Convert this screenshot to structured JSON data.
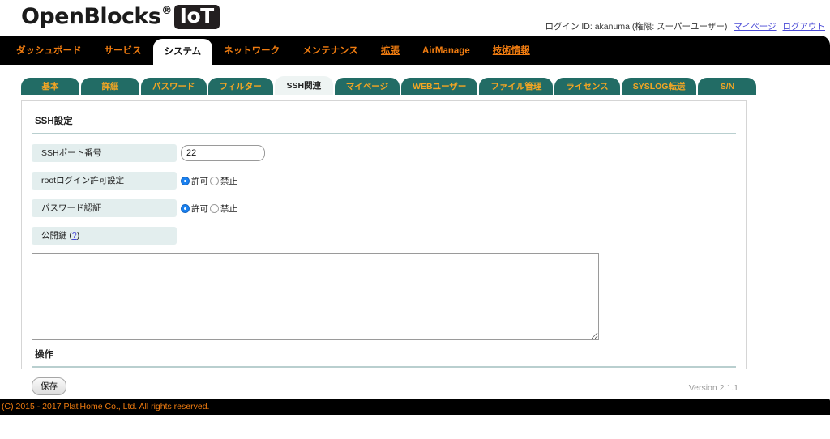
{
  "header": {
    "logo_main": "OpenBlocks",
    "logo_reg": "®",
    "logo_badge": "IoT",
    "login_text": "ログイン ID: akanuma (権限: スーパーユーザー)",
    "mypage_link": "マイページ",
    "logout_link": "ログアウト"
  },
  "mainnav": {
    "tabs": [
      {
        "label": "ダッシュボード",
        "active": false,
        "underline": false
      },
      {
        "label": "サービス",
        "active": false,
        "underline": false
      },
      {
        "label": "システム",
        "active": true,
        "underline": false
      },
      {
        "label": "ネットワーク",
        "active": false,
        "underline": false
      },
      {
        "label": "メンテナンス",
        "active": false,
        "underline": false
      },
      {
        "label": "拡張",
        "active": false,
        "underline": true
      },
      {
        "label": "AirManage",
        "active": false,
        "underline": false
      },
      {
        "label": "技術情報",
        "active": false,
        "underline": true
      }
    ]
  },
  "subnav": {
    "tabs": [
      {
        "label": "基本",
        "active": false
      },
      {
        "label": "詳細",
        "active": false
      },
      {
        "label": "パスワード",
        "active": false
      },
      {
        "label": "フィルター",
        "active": false
      },
      {
        "label": "SSH関連",
        "active": true
      },
      {
        "label": "マイページ",
        "active": false
      },
      {
        "label": "WEBユーザー",
        "active": false
      },
      {
        "label": "ファイル管理",
        "active": false
      },
      {
        "label": "ライセンス",
        "active": false
      },
      {
        "label": "SYSLOG転送",
        "active": false
      },
      {
        "label": "S/N",
        "active": false
      }
    ]
  },
  "panel": {
    "section_title": "SSH設定",
    "port_label": "SSHポート番号",
    "port_value": "22",
    "port_placeholder": "",
    "root_login_label": "rootログイン許可設定",
    "password_auth_label": "パスワード認証",
    "radio_allow": "許可",
    "radio_deny": "禁止",
    "root_login_selected": "許可",
    "password_auth_selected": "許可",
    "pubkey_label": "公開鍵",
    "pubkey_help": "(?)",
    "pubkey_help_mark": "?",
    "pubkey_value": "",
    "pubkey_placeholder": "",
    "operation_title": "操作",
    "save_label": "保存"
  },
  "footer": {
    "version": "Version 2.1.1",
    "copyright": "(C) 2015 - 2017 Plat'Home Co., Ltd. All rights reserved."
  },
  "colors": {
    "nav_bg": "#000000",
    "nav_text": "#f07c10",
    "subtab_bg": "#226c65",
    "subtab_text": "#f5a623",
    "label_bg": "#e3eeee",
    "divider": "#b9cfcf",
    "radio_checked": "#1a81f0"
  }
}
